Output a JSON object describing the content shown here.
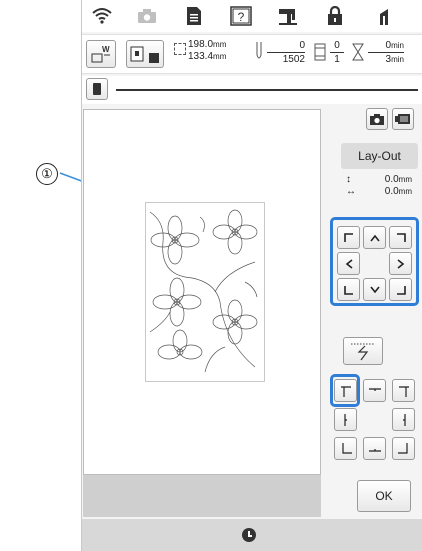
{
  "callout": {
    "number": "①"
  },
  "topbar": {
    "icons": [
      "wifi-icon",
      "camera-icon",
      "document-icon",
      "help-icon",
      "sewing-machine-icon",
      "home-icon",
      "thread-icon"
    ]
  },
  "info": {
    "width": "198.0",
    "height": "133.4",
    "unit": "mm",
    "stitch_current": "0",
    "stitch_total": "1502",
    "color_current": "0",
    "color_total": "1",
    "time_current": "0",
    "time_total": "3",
    "time_unit": "min"
  },
  "panel": {
    "layout_label": "Lay-Out",
    "move_vertical": "0.0",
    "move_horizontal": "0.0",
    "move_unit": "mm",
    "ok_label": "OK"
  },
  "colors": {
    "accent": "#2f7dd6",
    "callout_line": "#3a8fd9"
  }
}
